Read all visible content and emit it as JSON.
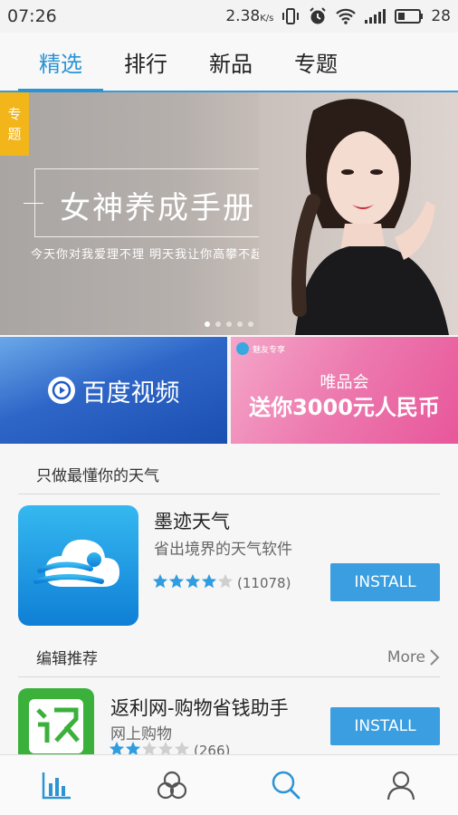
{
  "status_bar": {
    "time": "07:26",
    "speed": "2.38",
    "speed_unit": "K/s",
    "battery": "28"
  },
  "tabs": [
    {
      "label": "精选",
      "active": true
    },
    {
      "label": "排行",
      "active": false
    },
    {
      "label": "新品",
      "active": false
    },
    {
      "label": "专题",
      "active": false
    }
  ],
  "hero": {
    "badge_line1": "专",
    "badge_line2": "题",
    "title": "女神养成手册",
    "subtitle": "今天你对我爱理不理  明天我让你高攀不起",
    "dots": 5,
    "active_dot": 0
  },
  "promos": {
    "left": {
      "label": "百度视频"
    },
    "right": {
      "tag": "魅友专享",
      "brand": "唯品会",
      "offer": "送你3000元人民币"
    }
  },
  "weather_section": {
    "header": "只做最懂你的天气",
    "app": {
      "name": "墨迹天气",
      "description": "省出境界的天气软件",
      "rating": 4,
      "reviews": "(11078)",
      "install_label": "INSTALL"
    }
  },
  "editor_section": {
    "header": "编辑推荐",
    "more_label": "More",
    "app": {
      "name": "返利网-购物省钱助手",
      "description": "网上购物",
      "rating": 2,
      "reviews": "(266)",
      "install_label": "INSTALL"
    }
  },
  "colors": {
    "accent": "#2b94d5",
    "install": "#3a9ee0",
    "badge": "#f2b51a"
  },
  "bottom_nav": [
    {
      "icon": "chart-bars-icon",
      "active": true
    },
    {
      "icon": "categories-circles-icon",
      "active": false
    },
    {
      "icon": "search-icon",
      "active": false
    },
    {
      "icon": "person-icon",
      "active": false
    }
  ]
}
